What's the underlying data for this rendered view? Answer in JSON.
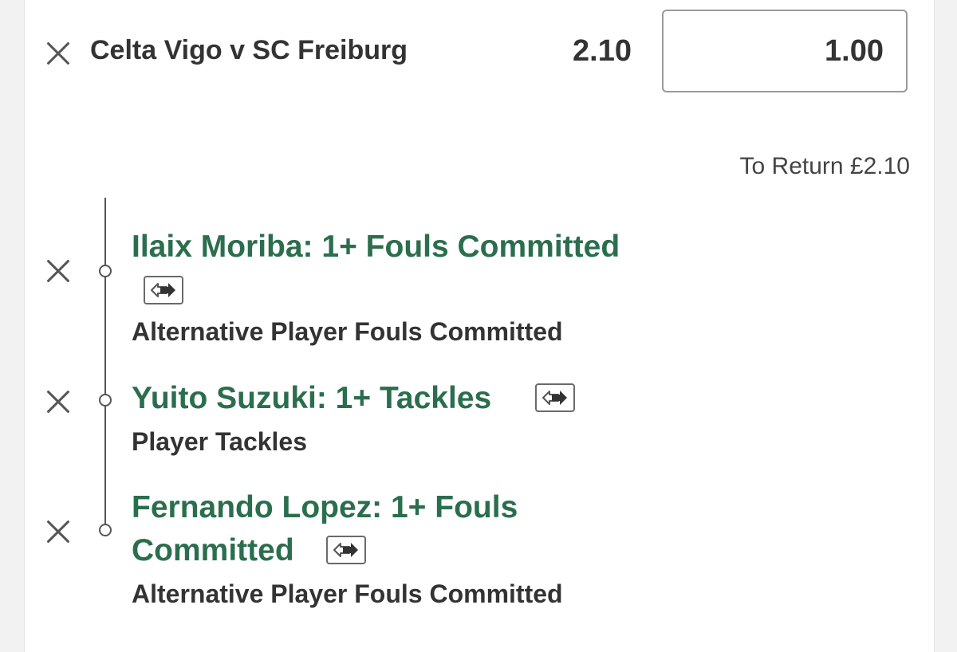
{
  "bet": {
    "match": "Celta Vigo v SC Freiburg",
    "odds": "2.10",
    "stake": "1.00",
    "to_return": "To Return £2.10"
  },
  "selections": [
    {
      "title_line1": "Ilaix Moriba: 1+ Fouls Committed",
      "title_line2": "",
      "market": "Alternative Player Fouls Committed"
    },
    {
      "title_line1": "Yuito Suzuki: 1+ Tackles",
      "title_line2": "",
      "market": "Player Tackles"
    },
    {
      "title_line1": "Fernando Lopez: 1+ Fouls",
      "title_line2": "Committed",
      "market": "Alternative Player Fouls Committed"
    }
  ],
  "icons": {
    "remove": "close-icon",
    "swap": "swap-icon"
  },
  "colors": {
    "selection_green": "#2b6e4e",
    "text_dark": "#333333"
  }
}
